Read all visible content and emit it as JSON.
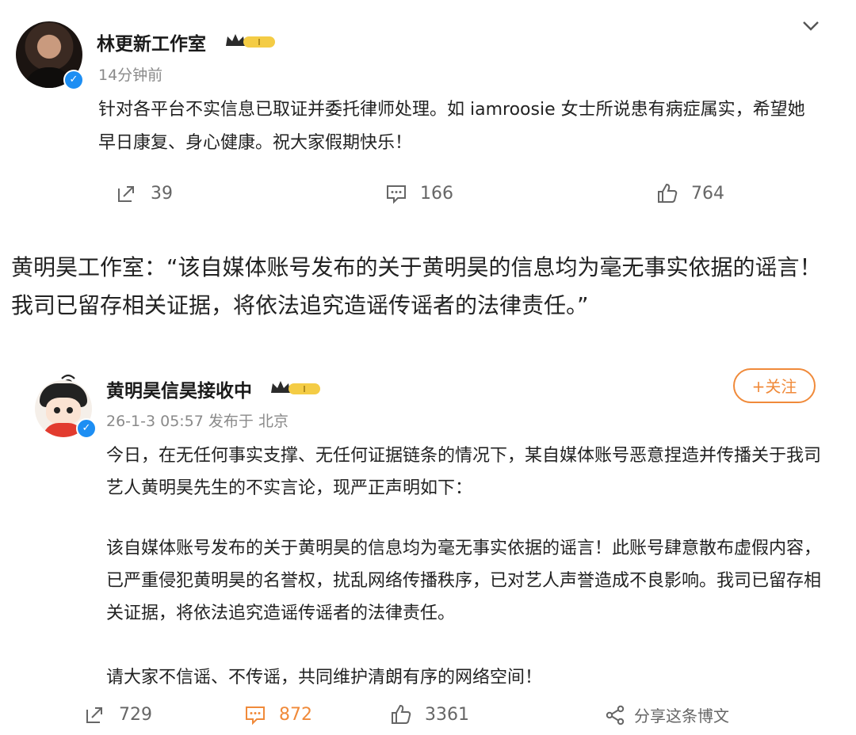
{
  "post1": {
    "author": "林更新工作室",
    "verified_mark": "✓",
    "time": "14分钟前",
    "text": "针对各平台不实信息已取证并委托律师处理。如 iamroosie 女士所说患有病症属实，希望她早日康复、身心健康。祝大家假期快乐！",
    "reposts": "39",
    "comments": "166",
    "likes": "764"
  },
  "quote": {
    "text": "黄明昊工作室：“该自媒体账号发布的关于黄明昊的信息均为毫无事实依据的谣言！我司已留存相关证据，将依法追究造谣传谣者的法律责任。”"
  },
  "post2": {
    "author": "黄明昊信昊接收中",
    "verified_mark": "✓",
    "meta": "26-1-3 05:57 发布于 北京",
    "follow_label": "+关注",
    "paragraphs": [
      "今日，在无任何事实支撑、无任何证据链条的情况下，某自媒体账号恶意捏造并传播关于我司艺人黄明昊先生的不实言论，现严正声明如下：",
      "该自媒体账号发布的关于黄明昊的信息均为毫无事实依据的谣言！此账号肆意散布虚假内容，已严重侵犯黄明昊的名誉权，扰乱网络传播秩序，已对艺人声誉造成不良影响。我司已留存相关证据，将依法追究造谣传谣者的法律责任。",
      "请大家不信谣、不传谣，共同维护清朗有序的网络空间！"
    ],
    "reposts": "729",
    "comments": "872",
    "likes": "3361",
    "share_label": "分享这条博文"
  },
  "colors": {
    "accent_orange": "#f08a3a",
    "verified_blue": "#1d8ef3",
    "crown_gold": "#e2b43a"
  },
  "icons": [
    "chevron-down-icon",
    "repost-icon",
    "comment-icon",
    "like-icon",
    "share-icon",
    "verified-icon",
    "crown-badge-icon"
  ]
}
